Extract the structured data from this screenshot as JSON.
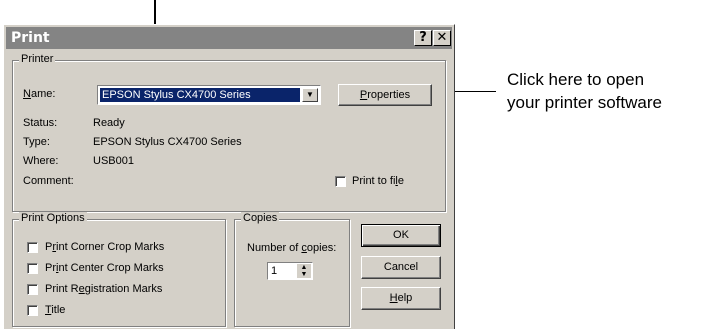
{
  "callout": {
    "line1": "Click here to open",
    "line2": "your printer software"
  },
  "dialog": {
    "title": "Print",
    "help_glyph": "?",
    "close_glyph": "✕"
  },
  "printer": {
    "group_label": "Printer",
    "name_label_u": "N",
    "name_label_rest": "ame:",
    "name_value": "EPSON Stylus CX4700 Series",
    "properties_u": "P",
    "properties_rest": "roperties",
    "status_label": "Status:",
    "status_value": "Ready",
    "type_label": "Type:",
    "type_value": "EPSON Stylus CX4700 Series",
    "where_label": "Where:",
    "where_value": "USB001",
    "comment_label": "Comment:",
    "print_to_file_pre": "Print to fi",
    "print_to_file_u": "l",
    "print_to_file_post": "e"
  },
  "options": {
    "group_label": "Print Options",
    "items": [
      {
        "pre": "P",
        "u": "r",
        "post": "int Corner Crop Marks"
      },
      {
        "pre": "Pr",
        "u": "i",
        "post": "nt Center Crop Marks"
      },
      {
        "pre": "Print R",
        "u": "e",
        "post": "gistration Marks"
      },
      {
        "pre": "",
        "u": "T",
        "post": "itle"
      }
    ]
  },
  "copies": {
    "group_label": "Copies",
    "number_pre": "Number of ",
    "number_u": "c",
    "number_post": "opies:",
    "value": "1"
  },
  "buttons": {
    "ok": "OK",
    "cancel": "Cancel",
    "help_u": "H",
    "help_rest": "elp"
  }
}
